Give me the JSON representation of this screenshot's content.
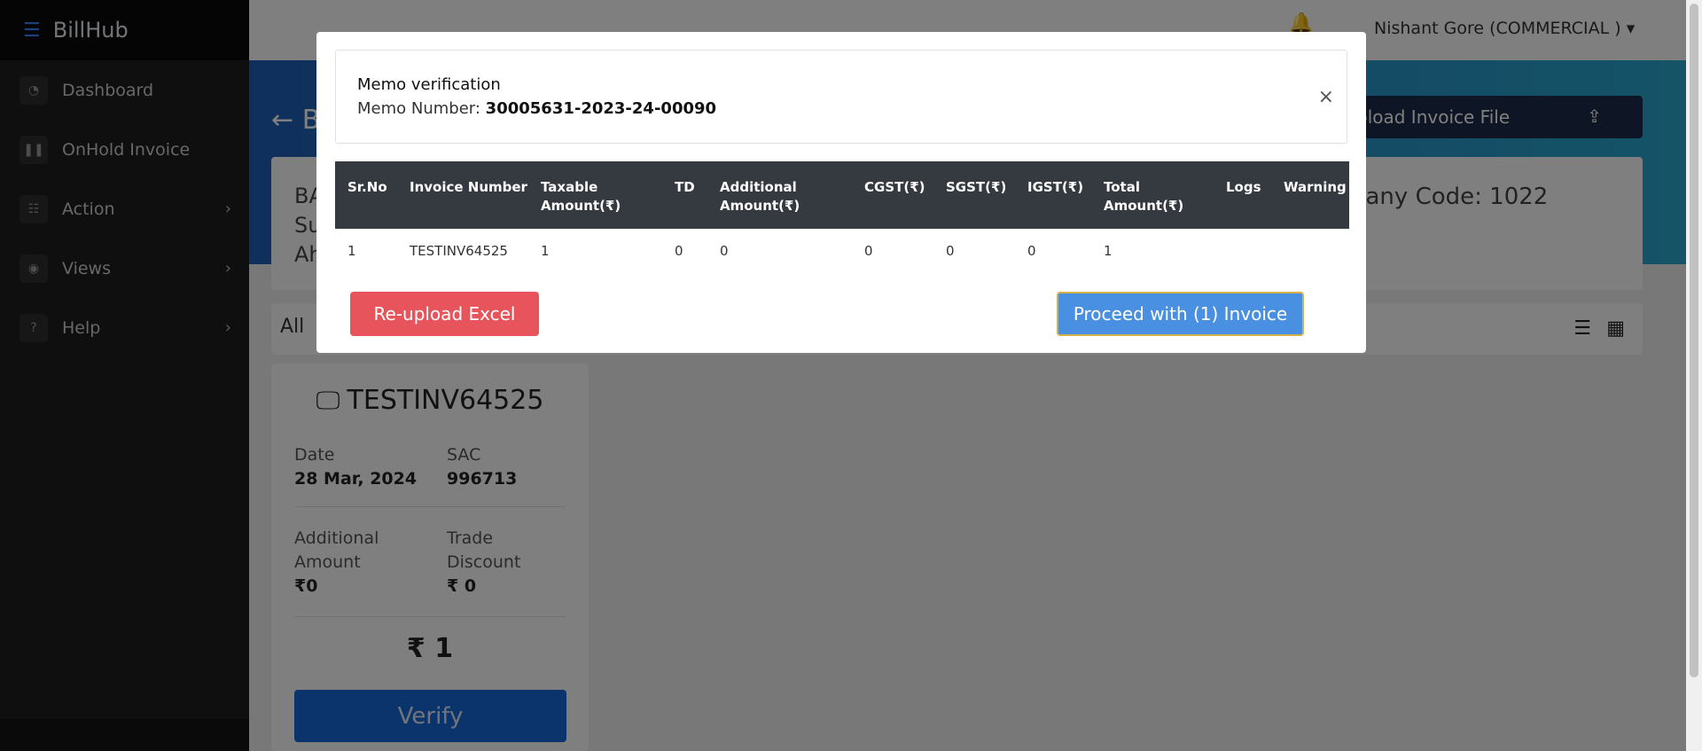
{
  "app": {
    "name": "BillHub"
  },
  "sidebar": {
    "items": [
      {
        "label": "Dashboard",
        "icon": "gauge-icon"
      },
      {
        "label": "OnHold Invoice",
        "icon": "pause-icon"
      },
      {
        "label": "Action",
        "icon": "list-icon"
      },
      {
        "label": "Views",
        "icon": "eye-icon"
      },
      {
        "label": "Help",
        "icon": "question-icon"
      }
    ]
  },
  "header": {
    "user": "Nishant Gore (COMMERCIAL )"
  },
  "page": {
    "title_partial": "B",
    "upload_label": "pload Invoice File",
    "info": {
      "line1": "BA",
      "line2": "Su",
      "line3": "Ah",
      "company": "pany Code: 1022"
    },
    "filter_label": "All"
  },
  "invoice_card": {
    "number": "TESTINV64525",
    "date_label": "Date",
    "date_value": "28 Mar, 2024",
    "sac_label": "SAC",
    "sac_value": "996713",
    "additional_label_1": "Additional",
    "additional_label_2": "Amount",
    "additional_value": "₹0",
    "trade_label_1": "Trade",
    "trade_label_2": "Discount",
    "trade_value": "₹ 0",
    "total": "₹ 1",
    "verify_label": "Verify"
  },
  "modal": {
    "title": "Memo verification",
    "memo_label": "Memo Number:",
    "memo_number": "30005631-2023-24-00090",
    "close": "×",
    "table": {
      "headers": [
        "Sr.No",
        "Invoice Number",
        "Taxable Amount(₹)",
        "TD",
        "Additional Amount(₹)",
        "CGST(₹)",
        "SGST(₹)",
        "IGST(₹)",
        "Total Amount(₹)",
        "Logs",
        "Warning"
      ],
      "rows": [
        [
          "1",
          "TESTINV64525",
          "1",
          "0",
          "0",
          "0",
          "0",
          "0",
          "1",
          "",
          ""
        ]
      ]
    },
    "reupload_label": "Re-upload Excel",
    "proceed_label": "Proceed with (1) Invoice"
  },
  "colors": {
    "sidebar": "#1f1f1f",
    "accent": "#1667d9",
    "danger": "#e8545c",
    "primary": "#4a90e2",
    "table_header": "#343a40"
  }
}
